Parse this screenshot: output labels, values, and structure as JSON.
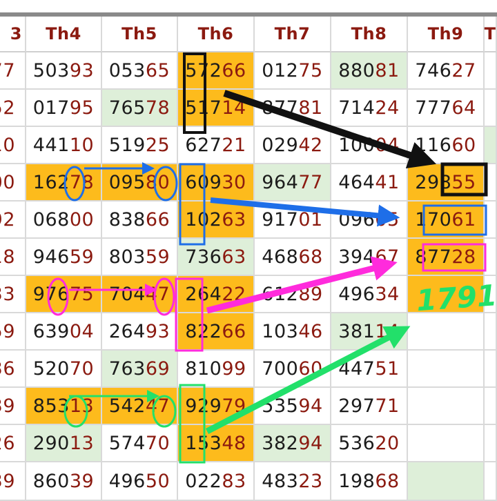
{
  "headers": [
    "3",
    "Th4",
    "Th5",
    "Th6",
    "Th7",
    "Th8",
    "Th9",
    "T"
  ],
  "rows": [
    [
      "77",
      "50393",
      "05365",
      "57266",
      "01275",
      "88081",
      "74627",
      ""
    ],
    [
      "52",
      "01795",
      "76578",
      "51714",
      "87781",
      "71424",
      "77764",
      ""
    ],
    [
      "10",
      "44110",
      "51925",
      "62721",
      "02942",
      "10004",
      "11660",
      ""
    ],
    [
      "00",
      "16278",
      "09580",
      "60930",
      "96477",
      "46441",
      "29855",
      ""
    ],
    [
      "92",
      "06800",
      "83866",
      "10263",
      "91701",
      "09605",
      "17061",
      ""
    ],
    [
      "18",
      "94659",
      "80359",
      "73663",
      "46868",
      "39467",
      "87728",
      ""
    ],
    [
      "33",
      "97675",
      "70447",
      "26422",
      "61289",
      "49634",
      "",
      ""
    ],
    [
      "59",
      "63904",
      "26493",
      "82266",
      "10346",
      "38114",
      "",
      ""
    ],
    [
      "36",
      "52070",
      "76369",
      "81099",
      "70060",
      "44751",
      "",
      ""
    ],
    [
      "39",
      "85313",
      "54247",
      "92979",
      "53594",
      "29771",
      "",
      ""
    ],
    [
      "26",
      "29013",
      "57470",
      "15348",
      "38294",
      "53620",
      "",
      ""
    ],
    [
      "39",
      "86039",
      "49650",
      "02283",
      "48323",
      "19868",
      "",
      ""
    ]
  ],
  "handwritten_prediction": "1791",
  "colors": {
    "header_text": "#8b1a10",
    "tail_digits": "#8b1a10",
    "highlight_yellow": "#fdbb1c",
    "highlight_green": "#deefd9",
    "arrow_black": "#111111",
    "arrow_blue": "#1e6ee8",
    "arrow_magenta": "#ff2bdc",
    "arrow_green": "#22e06a"
  }
}
